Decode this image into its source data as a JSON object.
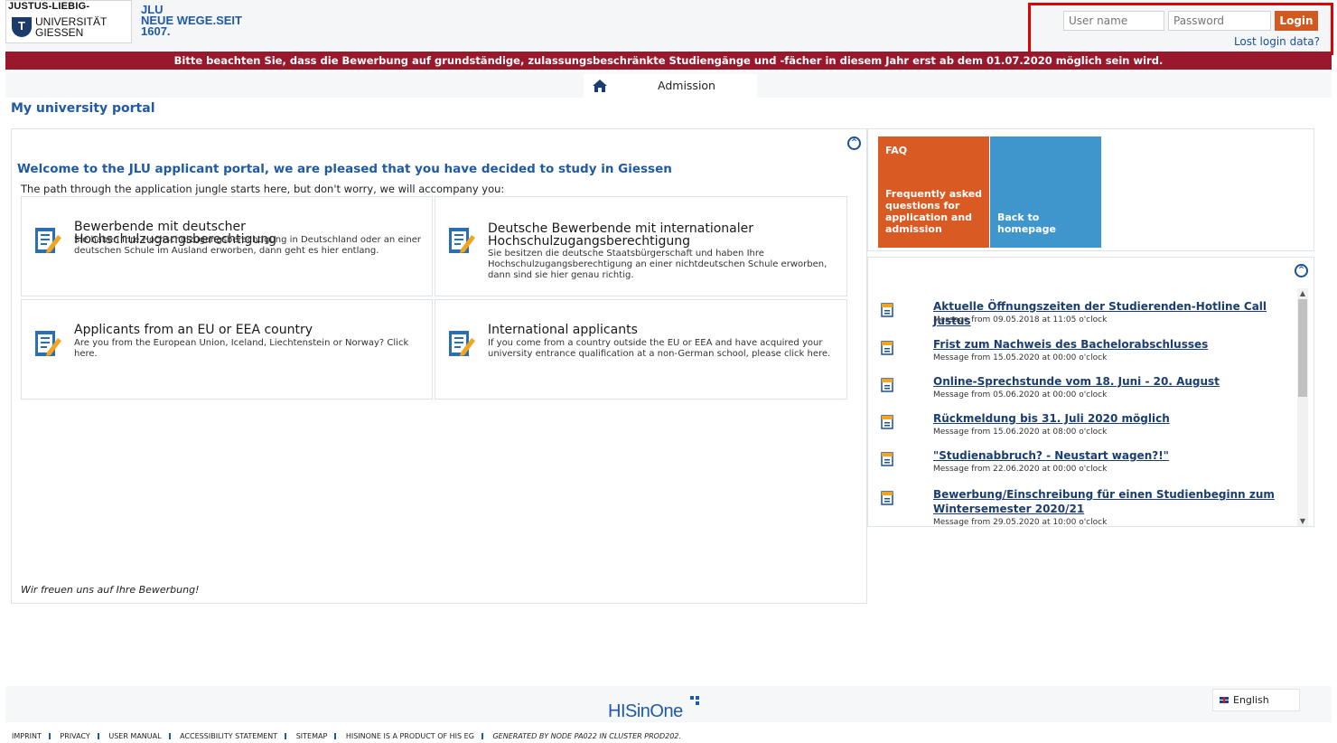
{
  "header": {
    "logo": {
      "line1": "JUSTUS-LIEBIG-",
      "line2": "UNIVERSITÄT",
      "line3": "GIESSEN",
      "seal": "T"
    },
    "slogan": {
      "line1": "JLU",
      "line2": "NEUE WEGE.SEIT",
      "line3": "1607."
    },
    "login": {
      "username_placeholder": "User name",
      "password_placeholder": "Password",
      "login_label": "Login",
      "lost_login": "Lost login data?"
    }
  },
  "notice": "Bitte beachten Sie, dass die Bewerbung auf grundständige, zulassungsbeschränkte Studiengänge und -fächer in diesem Jahr erst ab dem 01.07.2020 möglich sein wird.",
  "nav": {
    "home_icon": "home-icon",
    "tab_admission": "Admission"
  },
  "page_title": "My university portal",
  "main": {
    "welcome": "Welcome to the JLU applicant portal, we are pleased that you have decided to study in Giessen",
    "intro": "The path through the application jungle starts here, but don't worry, we will accompany you:",
    "boxes": [
      {
        "title": "Bewerbende mit deutscher Hochschulzugangsberechtigung",
        "desc": "Sie haben Ihre Hochschulzugangsberechtigung in Deutschland oder an einer deutschen Schule im Ausland erworben, dann geht es hier entlang."
      },
      {
        "title": "Deutsche Bewerbende mit internationaler Hochschulzugangsberechtigung",
        "desc": "Sie besitzen die deutsche Staatsbürgerschaft und haben Ihre Hochschulzugangsberechtigung an einer nichtdeutschen Schule erworben, dann sind sie hier genau richtig."
      },
      {
        "title": "Applicants from an EU or EEA country",
        "desc": "Are you from the European Union, Iceland, Liechtenstein or Norway? Click here."
      },
      {
        "title": "International applicants",
        "desc": "If you come from a country outside the EU or EEA and have acquired your university entrance qualification at a non-German school, please click here."
      }
    ],
    "closing": "Wir freuen uns auf Ihre Bewerbung!"
  },
  "tiles": {
    "faq": {
      "title": "FAQ",
      "desc": "Frequently asked questions for application and admission",
      "color": "#da5a24"
    },
    "home": {
      "desc": "Back to homepage",
      "color": "#3f96cc"
    }
  },
  "news": [
    {
      "title": "Aktuelle Öffnungszeiten der Studierenden-Hotline Call Justus",
      "date": "Message from 09.05.2018 at 11:05 o'clock"
    },
    {
      "title": "Frist zum Nachweis des Bachelorabschlusses",
      "date": "Message from 15.05.2020 at 00:00 o'clock"
    },
    {
      "title": "Online-Sprechstunde vom 18. Juni - 20. August",
      "date": "Message from 05.06.2020 at 00:00 o'clock"
    },
    {
      "title": "Rückmeldung bis 31. Juli 2020 möglich",
      "date": "Message from 15.06.2020 at 08:00 o'clock"
    },
    {
      "title": "\"Studienabbruch? - Neustart wagen?!\"",
      "date": "Message from 22.06.2020 at 00:00 o'clock"
    },
    {
      "title": "Bewerbung/Einschreibung für einen Studienbeginn zum Wintersemester 2020/21",
      "date": "Message from 29.05.2020 at 10:00 o'clock"
    }
  ],
  "footer": {
    "brand": "HISinOne",
    "language": "English",
    "links": [
      "IMPRINT",
      "PRIVACY",
      "USER MANUAL",
      "ACCESSIBILITY STATEMENT",
      "SITEMAP",
      "HISINONE IS A PRODUCT OF HIS EG"
    ],
    "generated": "GENERATED BY NODE PA022 IN CLUSTER PROD202."
  },
  "colors": {
    "brand_blue": "#1f5aa6",
    "notice_red": "#99182b",
    "login_orange": "#d2591f",
    "highlight_red": "#e00000"
  }
}
